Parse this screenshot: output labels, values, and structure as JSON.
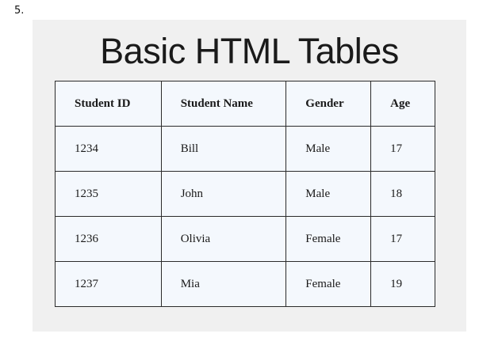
{
  "item_number": "5.",
  "title": "Basic HTML Tables",
  "table": {
    "headers": [
      "Student ID",
      "Student Name",
      "Gender",
      "Age"
    ],
    "rows": [
      [
        "1234",
        "Bill",
        "Male",
        "17"
      ],
      [
        "1235",
        "John",
        "Male",
        "18"
      ],
      [
        "1236",
        "Olivia",
        "Female",
        "17"
      ],
      [
        "1237",
        "Mia",
        "Female",
        "19"
      ]
    ]
  },
  "colors": {
    "panel_background": "#f0f0f0",
    "table_background": "#f4f8fd",
    "border": "#2b2b2b",
    "text": "#1a1a1a"
  }
}
